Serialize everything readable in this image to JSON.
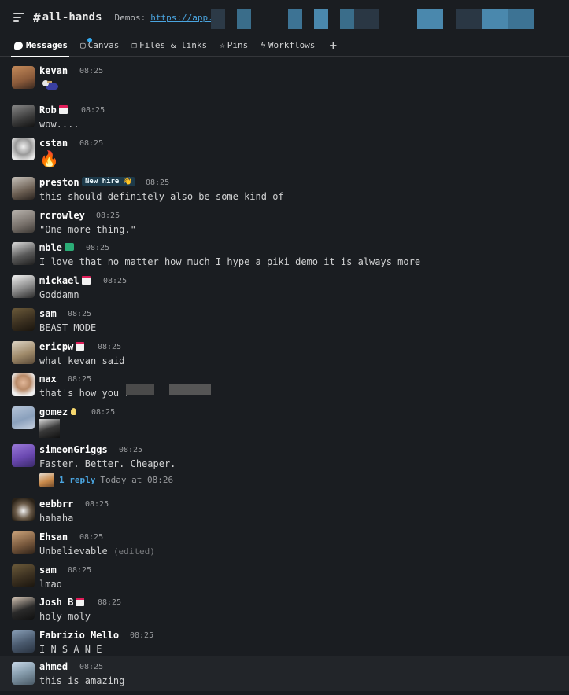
{
  "header": {
    "channel_hash": "#",
    "channel_name": "all-hands",
    "topic_label": "Demos:",
    "topic_link": "https://app."
  },
  "tabs": [
    {
      "label": "Messages",
      "icon": "message-bubble-icon"
    },
    {
      "label": "Canvas",
      "icon": "canvas-icon"
    },
    {
      "label": "Files & links",
      "icon": "files-icon"
    },
    {
      "label": "Pins",
      "icon": "pin-icon"
    },
    {
      "label": "Workflows",
      "icon": "lightning-icon"
    }
  ],
  "add_tab_label": "+",
  "messages": [
    {
      "name": "kevan",
      "time": "08:25",
      "text": "",
      "content": "animated-emoji"
    },
    {
      "name": "Rob",
      "time": "08:25",
      "text": "wow....",
      "status": "calendar"
    },
    {
      "name": "cstan",
      "time": "08:25",
      "text": "🔥"
    },
    {
      "name": "preston",
      "time": "08:25",
      "text": "this should definitely also be some kind of",
      "badge": "New hire 👋"
    },
    {
      "name": "rcrowley",
      "time": "08:25",
      "text": "\"One more thing.\""
    },
    {
      "name": "mble",
      "time": "08:25",
      "text": "I love that no matter how much I hype a piki demo it is always more",
      "status": "green"
    },
    {
      "name": "mickael",
      "time": "08:25",
      "text": "Goddamn",
      "status": "calendar"
    },
    {
      "name": "sam",
      "time": "08:25",
      "text": "BEAST MODE"
    },
    {
      "name": "ericpw",
      "time": "08:25",
      "text": "what kevan said",
      "status": "calendar"
    },
    {
      "name": "max",
      "time": "08:25",
      "text": "that's how you r"
    },
    {
      "name": "gomez",
      "time": "08:25",
      "text": "",
      "status": "bulb",
      "content": "image-thumbnail"
    },
    {
      "name": "simeonGriggs",
      "time": "08:25",
      "text": "Faster. Better. Cheaper.",
      "thread": {
        "count": "1 reply",
        "time": "Today at 08:26"
      }
    },
    {
      "name": "eebbrr",
      "time": "08:25",
      "text": "hahaha"
    },
    {
      "name": "Ehsan",
      "time": "08:25",
      "text": "Unbelievable",
      "edited": "(edited)"
    },
    {
      "name": "sam",
      "time": "08:25",
      "text": "lmao"
    },
    {
      "name": "Josh B",
      "time": "08:25",
      "text": "holy moly",
      "status": "calendar"
    },
    {
      "name": "Fabrízio Mello",
      "time": "08:25",
      "text": "I N S A N E"
    },
    {
      "name": "ahmed",
      "time": "08:25",
      "text": "this is amazing"
    }
  ],
  "colors": {
    "background": "#1a1d21",
    "link": "#4aa5e0",
    "hover_row": "#222529"
  }
}
